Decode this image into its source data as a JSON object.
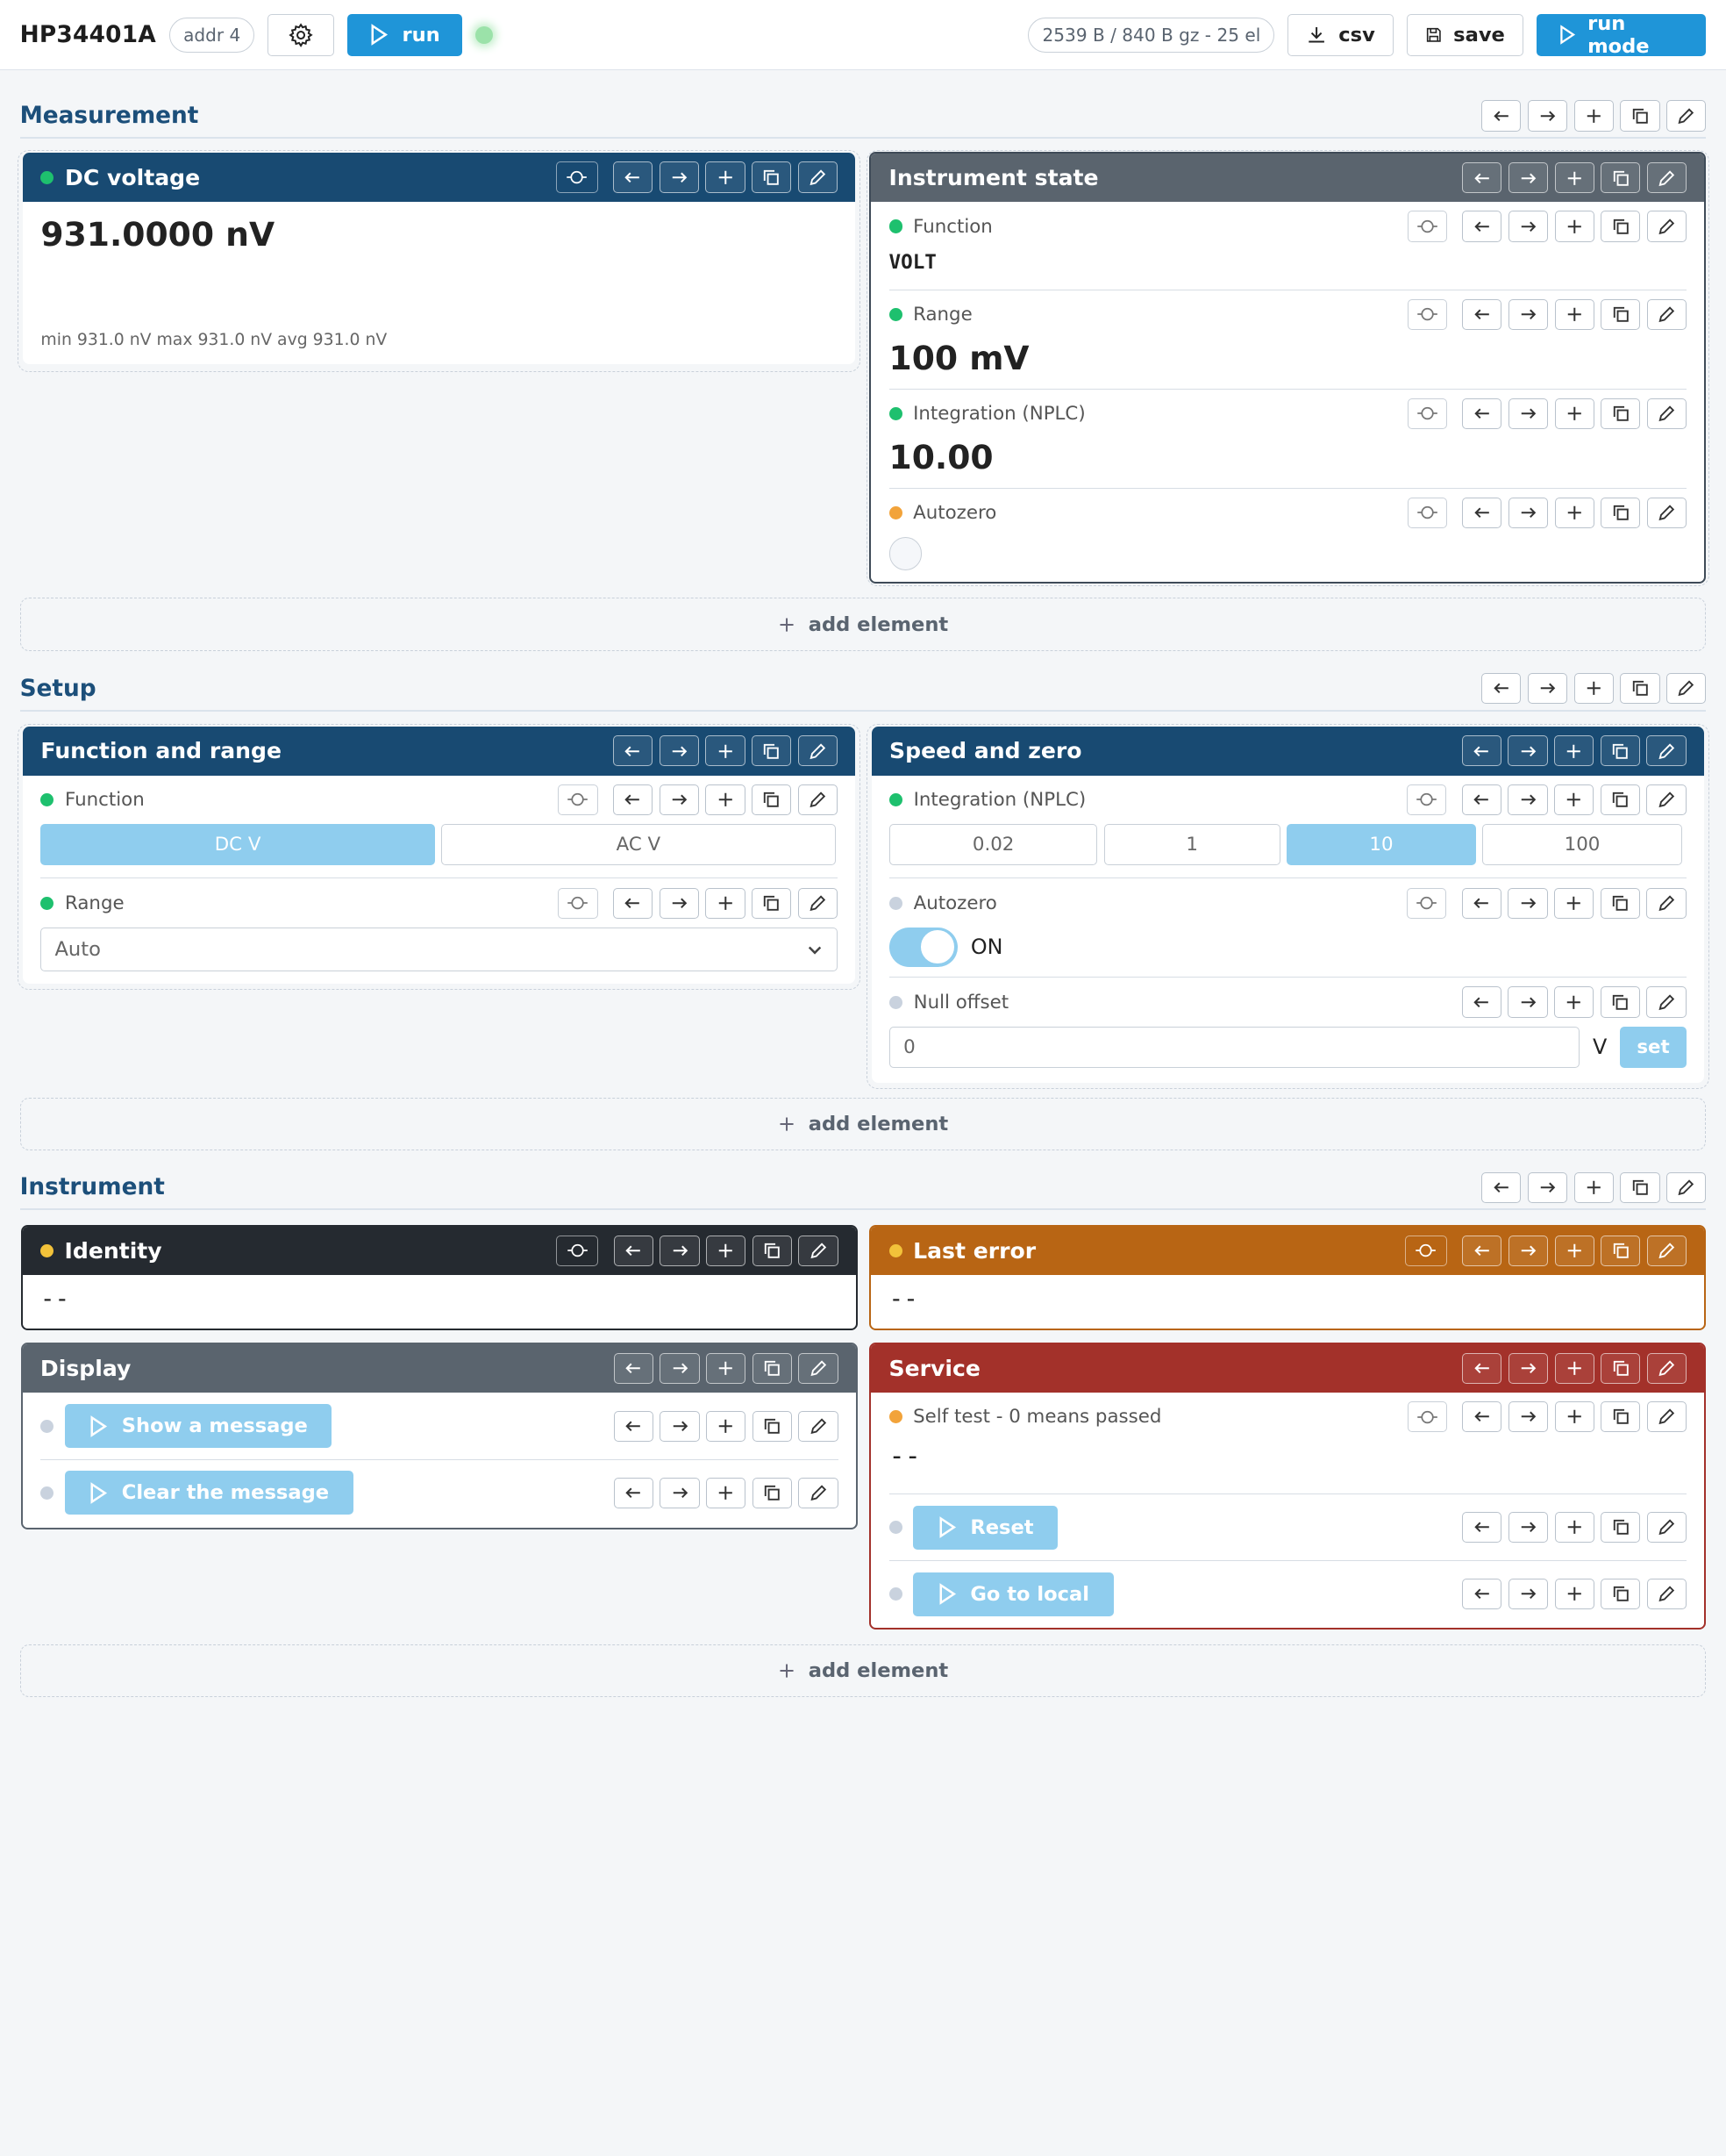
{
  "topbar": {
    "title": "HP34401A",
    "addr": "addr 4",
    "run_label": "run",
    "stats": "2539 B / 840 B gz - 25 el",
    "csv_label": "csv",
    "save_label": "save",
    "run_mode_label": "run mode"
  },
  "add_element_label": "add element",
  "sections": {
    "measurement": {
      "title": "Measurement"
    },
    "setup": {
      "title": "Setup"
    },
    "instrument": {
      "title": "Instrument"
    }
  },
  "dc_voltage": {
    "title": "DC voltage",
    "value": "931.0000 nV",
    "stats": "min 931.0 nV max 931.0 nV avg 931.0 nV"
  },
  "instrument_state": {
    "title": "Instrument state",
    "function_label": "Function",
    "function_value": "VOLT",
    "range_label": "Range",
    "range_value": "100 mV",
    "nplc_label": "Integration (NPLC)",
    "nplc_value": "10.00",
    "autozero_label": "Autozero"
  },
  "function_range": {
    "title": "Function and range",
    "function_label": "Function",
    "options": [
      "DC V",
      "AC V"
    ],
    "selected": "DC V",
    "range_label": "Range",
    "range_value": "Auto"
  },
  "speed_zero": {
    "title": "Speed and zero",
    "nplc_label": "Integration (NPLC)",
    "nplc_options": [
      "0.02",
      "1",
      "10",
      "100"
    ],
    "nplc_selected": "10",
    "autozero_label": "Autozero",
    "autozero_state": "ON",
    "null_label": "Null offset",
    "null_value": "0",
    "null_unit": "V",
    "set_label": "set"
  },
  "identity": {
    "title": "Identity",
    "value": "--"
  },
  "last_error": {
    "title": "Last error",
    "value": "--"
  },
  "display": {
    "title": "Display",
    "show_label": "Show a message",
    "clear_label": "Clear the message"
  },
  "service": {
    "title": "Service",
    "selftest_label": "Self test - 0 means passed",
    "selftest_value": "--",
    "reset_label": "Reset",
    "local_label": "Go to local"
  },
  "colors": {
    "primary": "#1f95d8",
    "header_blue": "#184a72",
    "header_gray": "#5a646e",
    "header_dark": "#252a30",
    "header_orange": "#b86514",
    "header_red": "#a3312a",
    "status_green": "#1ec06e",
    "status_orange": "#f2a33a"
  }
}
